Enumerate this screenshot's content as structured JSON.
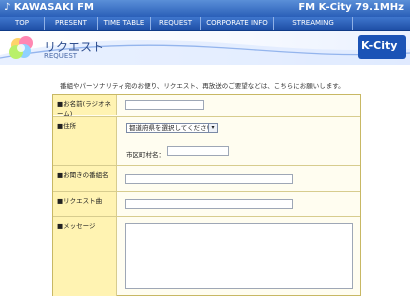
{
  "header": {
    "site_title": "♪ KAWASAKI FM",
    "station": "FM K-City 79.1MHz",
    "nav": [
      "TOP",
      "PRESENT",
      "TIME TABLE",
      "REQUEST",
      "CORPORATE INFO",
      "STREAMING"
    ]
  },
  "page": {
    "title": "リクエスト",
    "subtitle": "REQUEST",
    "intro": "番組やパーソナリティ宛のお便り、リクエスト、再放送のご要望などは、こちらにお願いします。"
  },
  "logo": {
    "text": "K-City"
  },
  "form": {
    "name_label": "■お名前(ラジオネーム)",
    "address_label": "■住所",
    "prefecture_select": "都道府県を選択してください",
    "city_label": "市区町村名：",
    "program_label": "■お聞きの番組名",
    "song_label": "■リクエスト曲",
    "message_label": "■メッセージ"
  }
}
